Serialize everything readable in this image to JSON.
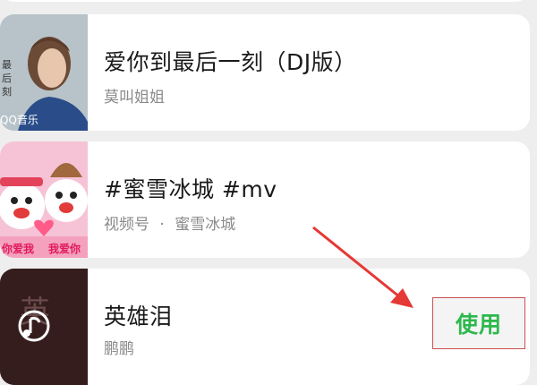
{
  "songs": [
    {
      "title": "爱你到最后一刻（DJ版）",
      "artist": "莫叫姐姐",
      "cover_label": "QQ音乐",
      "cover_partial_text": "最后一刻"
    },
    {
      "title": "#蜜雪冰城 #mv",
      "source": "视频号",
      "separator": "·",
      "artist": "蜜雪冰城",
      "cover_text_left": "你爱我",
      "cover_text_right": "我爱你"
    },
    {
      "title": "英雄泪",
      "artist": "鹏鹏",
      "cover_text": "英雄泪"
    }
  ],
  "actions": {
    "use_label": "使用"
  },
  "colors": {
    "use_green": "#2db84d",
    "highlight_red": "#c85050",
    "arrow_red": "#e53935"
  }
}
